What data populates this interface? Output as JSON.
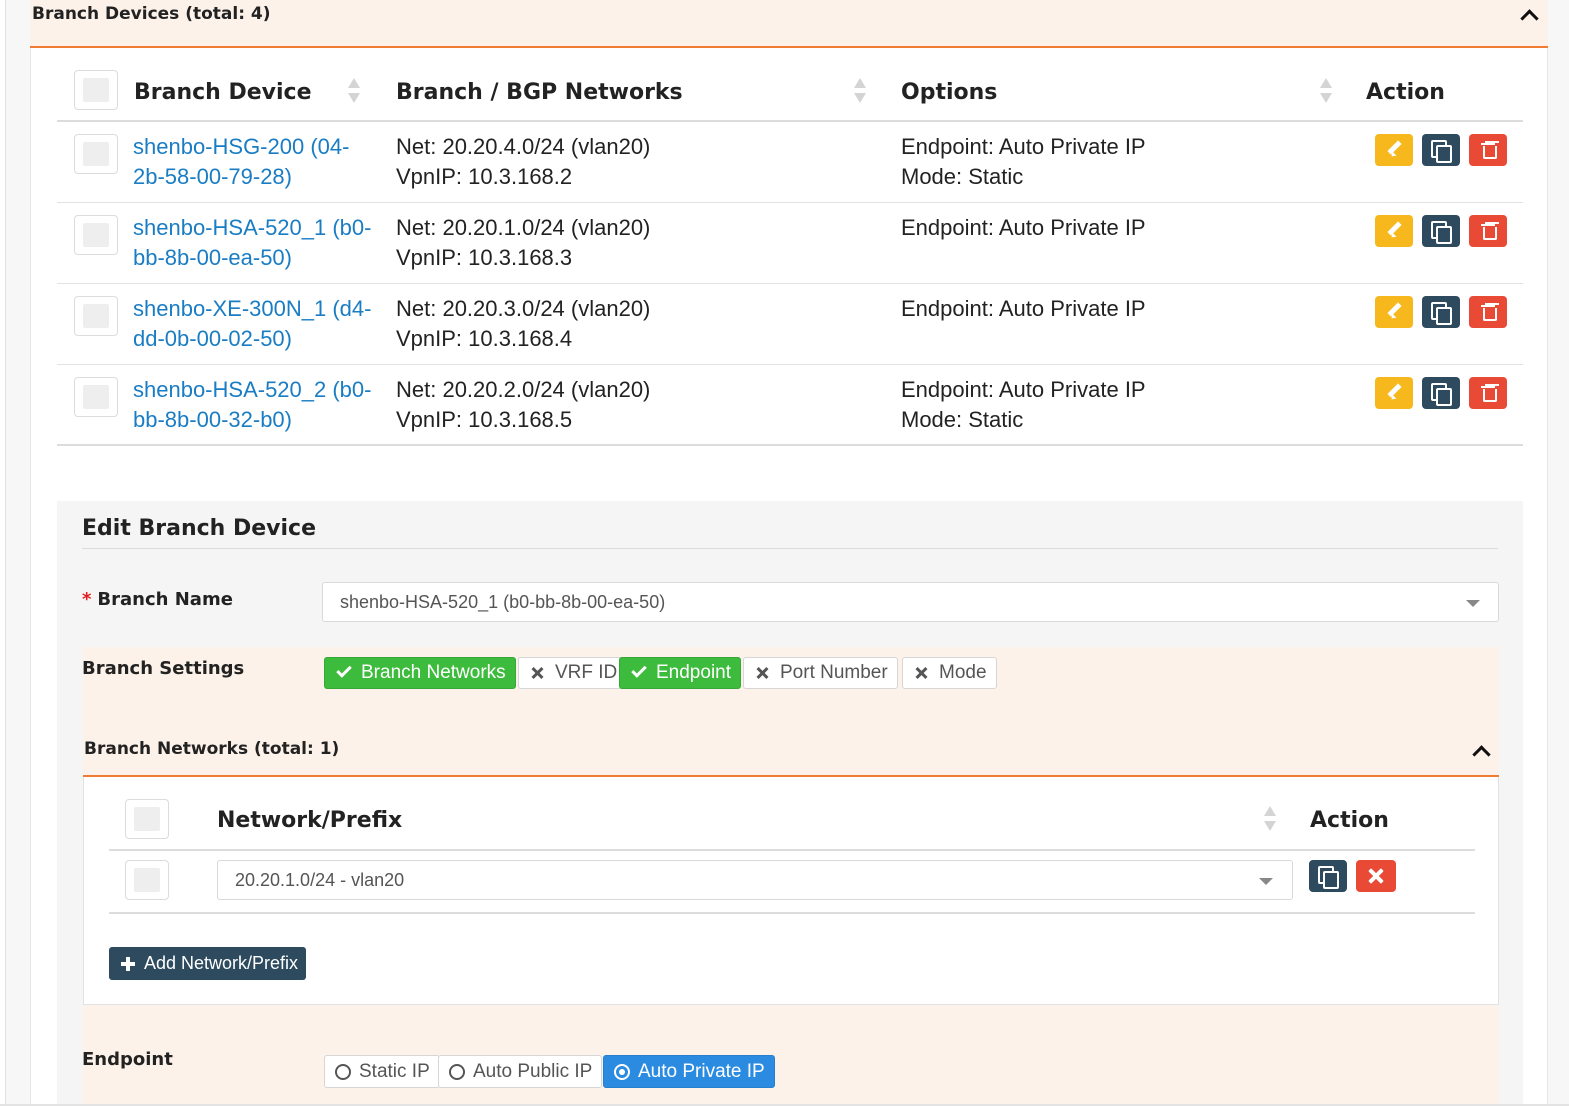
{
  "panel": {
    "title": "Branch Devices (total: 4)"
  },
  "table": {
    "headers": {
      "device": "Branch Device",
      "networks": "Branch / BGP Networks",
      "options": "Options",
      "action": "Action"
    },
    "rows": [
      {
        "device_line1": "shenbo-HSG-200 (04-",
        "device_line2": "2b-58-00-79-28)",
        "net": "Net: 20.20.4.0/24 (vlan20)",
        "vpnip": "VpnIP: 10.3.168.2",
        "endpoint": "Endpoint: Auto Private IP",
        "mode": "Mode: Static"
      },
      {
        "device_line1": "shenbo-HSA-520_1 (b0-",
        "device_line2": "bb-8b-00-ea-50)",
        "net": "Net: 20.20.1.0/24 (vlan20)",
        "vpnip": "VpnIP: 10.3.168.3",
        "endpoint": "Endpoint: Auto Private IP",
        "mode": ""
      },
      {
        "device_line1": "shenbo-XE-300N_1 (d4-",
        "device_line2": "dd-0b-00-02-50)",
        "net": "Net: 20.20.3.0/24 (vlan20)",
        "vpnip": "VpnIP: 10.3.168.4",
        "endpoint": "Endpoint: Auto Private IP",
        "mode": ""
      },
      {
        "device_line1": "shenbo-HSA-520_2 (b0-",
        "device_line2": "bb-8b-00-32-b0)",
        "net": "Net: 20.20.2.0/24 (vlan20)",
        "vpnip": "VpnIP: 10.3.168.5",
        "endpoint": "Endpoint: Auto Private IP",
        "mode": "Mode: Static"
      }
    ]
  },
  "edit": {
    "title": "Edit Branch Device",
    "branch_name_required_mark": "*",
    "branch_name_label": "Branch Name",
    "branch_name_value": "shenbo-HSA-520_1 (b0-bb-8b-00-ea-50)",
    "settings_label": "Branch Settings",
    "settings": [
      {
        "label": "Branch Networks",
        "active": true
      },
      {
        "label": "VRF ID",
        "active": false
      },
      {
        "label": "Endpoint",
        "active": true
      },
      {
        "label": "Port Number",
        "active": false
      },
      {
        "label": "Mode",
        "active": false
      }
    ],
    "networks_panel_title": "Branch Networks (total: 1)",
    "networks_headers": {
      "prefix": "Network/Prefix",
      "action": "Action"
    },
    "network_rows": [
      {
        "value": "20.20.1.0/24 - vlan20"
      }
    ],
    "add_network_label": "Add Network/Prefix",
    "endpoint_label": "Endpoint",
    "endpoint_options": [
      {
        "label": "Static IP",
        "selected": false
      },
      {
        "label": "Auto Public IP",
        "selected": false
      },
      {
        "label": "Auto Private IP",
        "selected": true
      }
    ]
  },
  "colors": {
    "accent_orange": "#f07c34",
    "panel_header_bg": "#fdf2ea",
    "link_blue": "#1a7dc4",
    "edit_yellow": "#f6b81c",
    "copy_navy": "#2d4a5e",
    "delete_red": "#e84a36",
    "toggle_green": "#3dbb3d",
    "radio_blue": "#2b8be0"
  },
  "icons": [
    "chevron-up-icon",
    "sort-icon",
    "pencil-icon",
    "copy-icon",
    "trash-icon",
    "times-icon",
    "check-icon",
    "plus-icon",
    "radio-icon",
    "caret-down-icon"
  ]
}
